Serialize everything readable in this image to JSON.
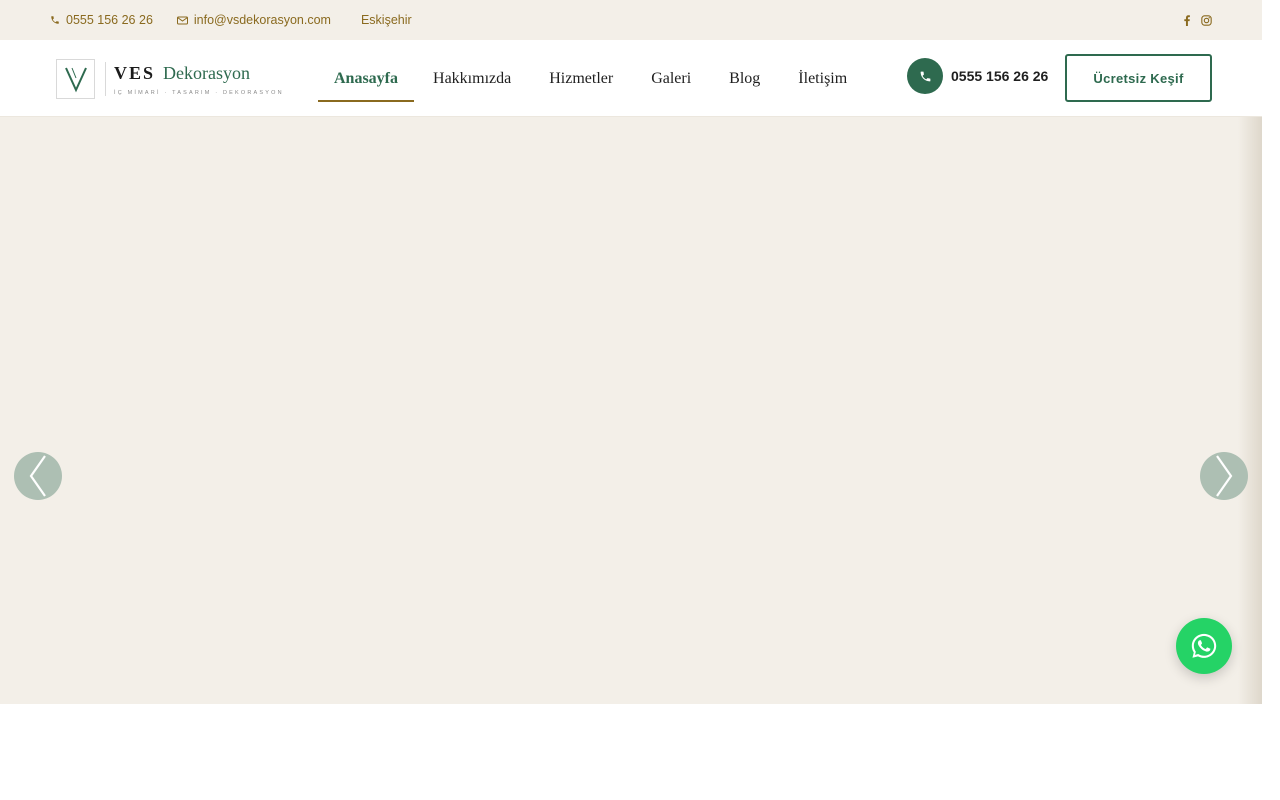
{
  "topbar": {
    "phone": "0555 156 26 26",
    "email": "info@vsdekorasyon.com",
    "location": "Eskişehir",
    "social": [
      {
        "icon": "facebook-icon"
      },
      {
        "icon": "instagram-icon"
      }
    ]
  },
  "logo": {
    "title_bold": "VES",
    "title_rest": "Dekorasyon",
    "subtitle": "İÇ MİMARİ · TASARIM · DEKORASYON"
  },
  "nav": {
    "items": [
      {
        "label": "Anasayfa",
        "active": true
      },
      {
        "label": "Hakkımızda",
        "active": false
      },
      {
        "label": "Hizmetler",
        "active": false
      },
      {
        "label": "Galeri",
        "active": false
      },
      {
        "label": "Blog",
        "active": false
      },
      {
        "label": "İletişim",
        "active": false
      }
    ]
  },
  "header": {
    "phone": "0555 156 26 26",
    "cta_label": "Ücretsiz Keşif"
  },
  "hero": {
    "prev_icon": "chevron-left-icon",
    "next_icon": "chevron-right-icon"
  },
  "whatsapp": {
    "icon": "whatsapp-icon"
  },
  "colors": {
    "brand_green": "#2e6a4f",
    "accent_gold": "#8a6a1f",
    "beige_bg": "#f3efe8",
    "whatsapp_green": "#25d366"
  }
}
